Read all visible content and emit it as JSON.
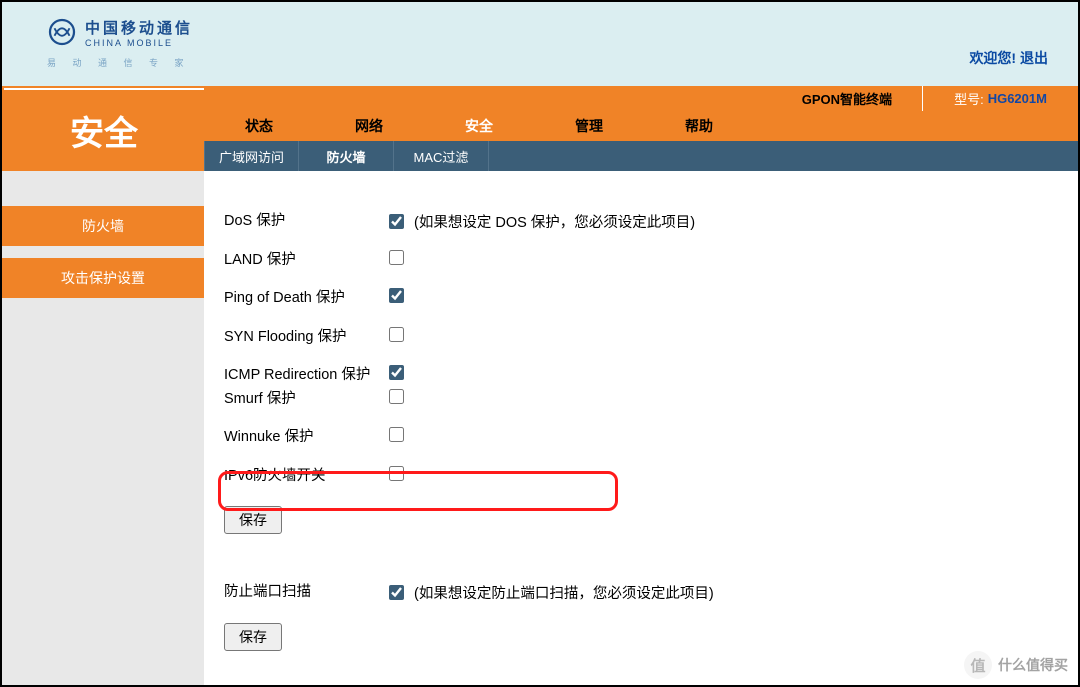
{
  "brand": {
    "cn": "中国移动通信",
    "en": "CHINA MOBILE",
    "sub": "易 动 通 信 专 家"
  },
  "header": {
    "welcome": "欢迎您!",
    "logout": "退出"
  },
  "topbar": {
    "device": "GPON智能终端",
    "model_label": "型号:",
    "model_value": "HG6201M"
  },
  "nav": {
    "tabs": [
      "状态",
      "网络",
      "安全",
      "管理",
      "帮助"
    ],
    "active_index": 2
  },
  "subnav": {
    "tabs": [
      "广域网访问",
      "防火墙",
      "MAC过滤"
    ],
    "active_index": 1
  },
  "page_title": "安全",
  "sidebar": {
    "items": [
      "防火墙",
      "攻击保护设置"
    ]
  },
  "form": {
    "rows": [
      {
        "label": "DoS 保护",
        "checked": true,
        "note": "(如果想设定 DOS 保护，您必须设定此项目)"
      },
      {
        "label": "LAND 保护",
        "checked": false
      },
      {
        "label": "Ping of Death 保护",
        "checked": true
      },
      {
        "label": "SYN Flooding 保护",
        "checked": false
      },
      {
        "label": "ICMP Redirection 保护",
        "checked": true
      },
      {
        "label": "Smurf 保护",
        "checked": false
      },
      {
        "label": "Winnuke 保护",
        "checked": false
      },
      {
        "label": "IPv6防火墙开关",
        "checked": false
      }
    ],
    "save1": "保存",
    "portscan": {
      "label": "防止端口扫描",
      "checked": true,
      "note": "(如果想设定防止端口扫描，您必须设定此项目)"
    },
    "save2": "保存"
  },
  "watermark": {
    "icon": "值",
    "text": "什么值得买"
  }
}
